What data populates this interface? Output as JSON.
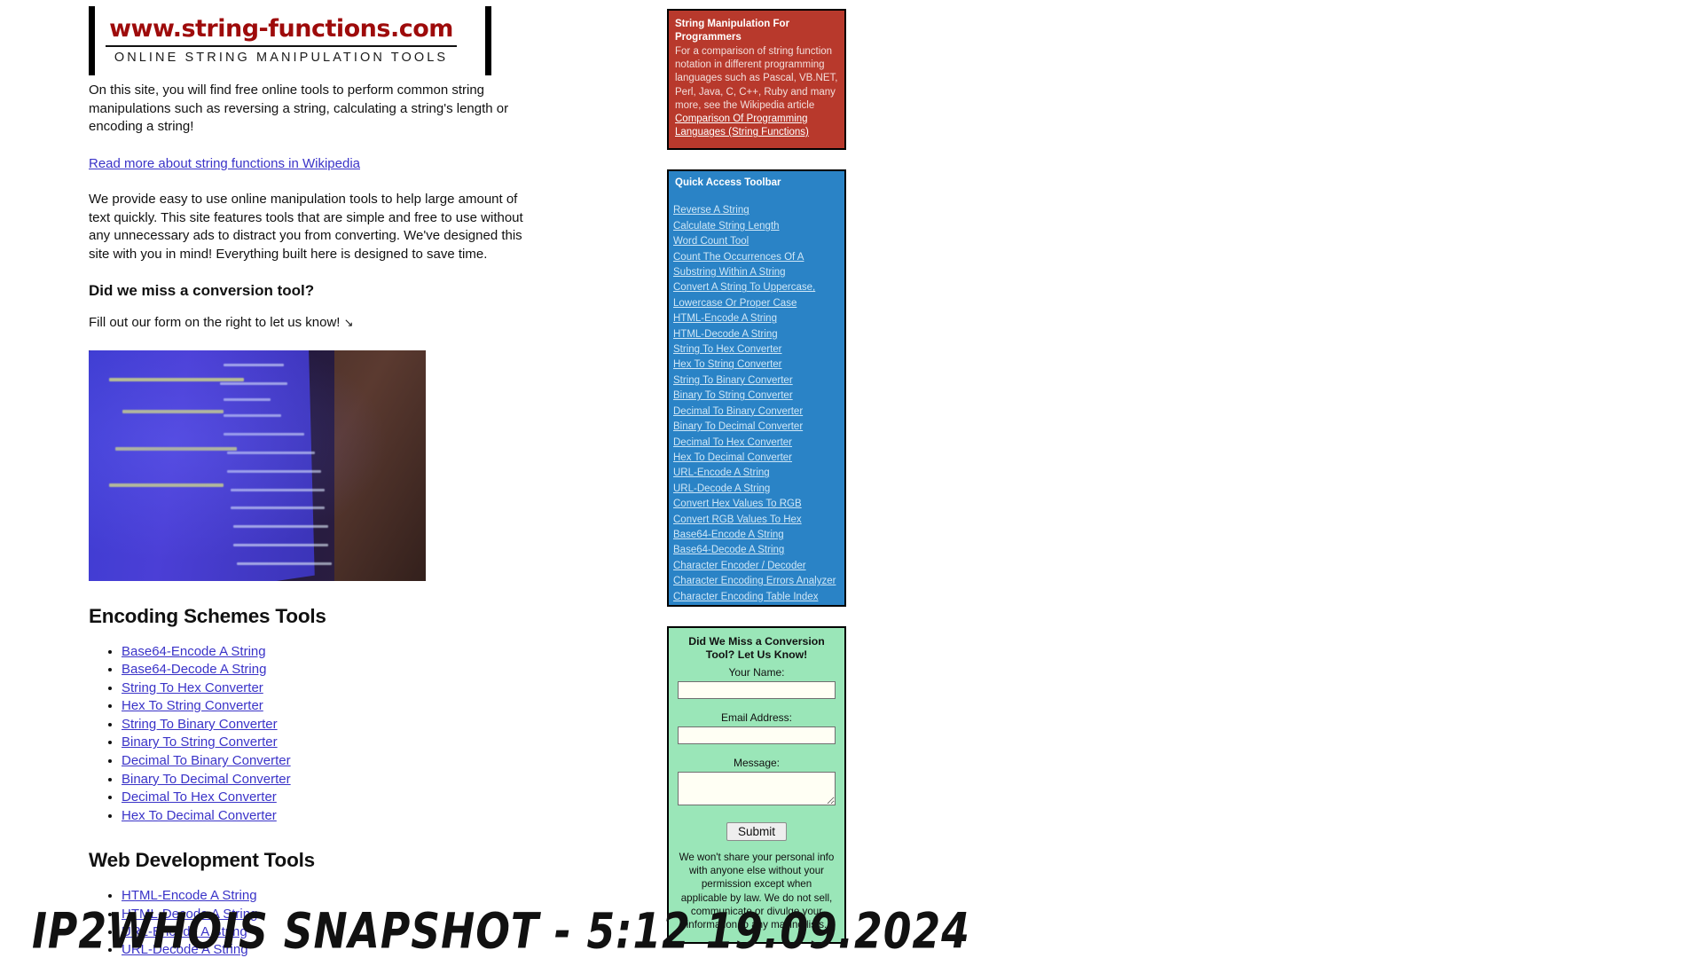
{
  "logo": {
    "domain": "www.string-functions.com",
    "tagline": "ONLINE STRING MANIPULATION TOOLS"
  },
  "main": {
    "intro": "On this site, you will find free online tools to perform common string manipulations such as reversing a string, calculating a string's length or encoding a string!",
    "wikipedia_link": "Read more about string functions in Wikipedia",
    "description": "We provide easy to use online manipulation tools to help large amount of text quickly. This site features tools that are simple and free to use without any unnecessary ads to distract you from converting. We've designed this site with you in mind! Everything built here is designed to save time.",
    "miss_heading": "Did we miss a conversion tool?",
    "miss_text": "Fill out our form on the right to let us know!",
    "arrow_glyph": "↘",
    "photo_alt": "code-on-monitor-photo",
    "sections": [
      {
        "heading": "Encoding Schemes Tools",
        "items": [
          "Base64-Encode A String",
          "Base64-Decode A String",
          "String To Hex Converter",
          "Hex To String Converter",
          "String To Binary Converter",
          "Binary To String Converter",
          "Decimal To Binary Converter",
          "Binary To Decimal Converter",
          "Decimal To Hex Converter",
          "Hex To Decimal Converter"
        ]
      },
      {
        "heading": "Web Development Tools",
        "items": [
          "HTML-Encode A String",
          "HTML-Decode A String",
          "URL-Encode A String",
          "URL-Decode A String"
        ]
      }
    ]
  },
  "sidebar": {
    "promo": {
      "title": "String Manipulation For Programmers",
      "body_before": "For a comparison of string function notation in different programming languages such as Pascal, VB.NET, Perl, Java, C, C++, Ruby and many more, see the Wikipedia article ",
      "link": "Comparison Of Programming Languages (String Functions)"
    },
    "quick_access": {
      "title": "Quick Access Toolbar",
      "links": [
        "Reverse A String",
        "Calculate String Length",
        "Word Count Tool",
        "Count The Occurrences Of A Substring Within A String",
        "Convert A String To Uppercase, Lowercase Or Proper Case",
        "HTML-Encode A String",
        "HTML-Decode A String",
        "String To Hex Converter",
        "Hex To String Converter",
        "String To Binary Converter",
        "Binary To String Converter",
        "Decimal To Binary Converter",
        "Binary To Decimal Converter",
        "Decimal To Hex Converter",
        "Hex To Decimal Converter",
        "URL-Encode A String",
        "URL-Decode A String",
        "Convert Hex Values To RGB",
        "Convert RGB Values To Hex",
        "Base64-Encode A String",
        "Base64-Decode A String",
        "Character Encoder / Decoder",
        "Character Encoding Errors Analyzer",
        "Character Encoding Table Index"
      ]
    },
    "contact_form": {
      "title": "Did We Miss a Conversion Tool? Let Us Know!",
      "name_label": "Your Name:",
      "name_value": "",
      "name_placeholder": "",
      "email_label": "Email Address:",
      "email_value": "",
      "email_placeholder": "",
      "message_label": "Message:",
      "message_value": "",
      "message_placeholder": "",
      "submit_label": "Submit",
      "privacy": "We won't share your personal info with anyone else without your permission except when applicable by law. We do not sell, communicate or divulge your information to any mailing lists."
    }
  },
  "watermark": {
    "text": "IP2WHOIS SNAPSHOT - 5:12 19.09.2024"
  },
  "colors": {
    "promo_red": "#b8392c",
    "toolbar_blue": "#2a83c6",
    "form_green": "#9ae6b8",
    "link_purple": "#3a33c8",
    "logo_red": "#9e0b0b"
  }
}
